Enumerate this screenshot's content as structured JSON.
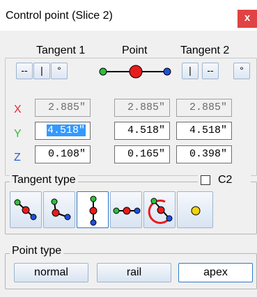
{
  "window": {
    "title": "Control point (Slice 2)",
    "close_label": "x"
  },
  "headers": {
    "tangent1": "Tangent 1",
    "point": "Point",
    "tangent2": "Tangent 2"
  },
  "tangent1_buttons": [
    "--",
    "|",
    "°"
  ],
  "tangent2_buttons": [
    "|",
    "--",
    "°"
  ],
  "axes": {
    "x": "X",
    "y": "Y",
    "z": "Z"
  },
  "axis_colors": {
    "x": "#e8283c",
    "y": "#2fbf3e",
    "z": "#2a5fd4"
  },
  "values": {
    "x": [
      "2.885\"",
      "2.885\"",
      "2.885\""
    ],
    "y": [
      "4.518\"",
      "4.518\"",
      "4.518\""
    ],
    "z": [
      "0.108\"",
      "0.165\"",
      "0.398\""
    ]
  },
  "tangent_type": {
    "label": "Tangent type",
    "c2_label": "C2",
    "c2_checked": false,
    "icons": [
      "diagonal-tangent-icon",
      "corner-tangent-icon",
      "vertical-tangent-icon",
      "horizontal-tangent-icon",
      "curved-tangent-icon",
      "single-point-icon"
    ],
    "selected_index": 2
  },
  "point_type": {
    "label": "Point type",
    "options": [
      "normal",
      "rail",
      "apex"
    ],
    "selected": "apex"
  }
}
